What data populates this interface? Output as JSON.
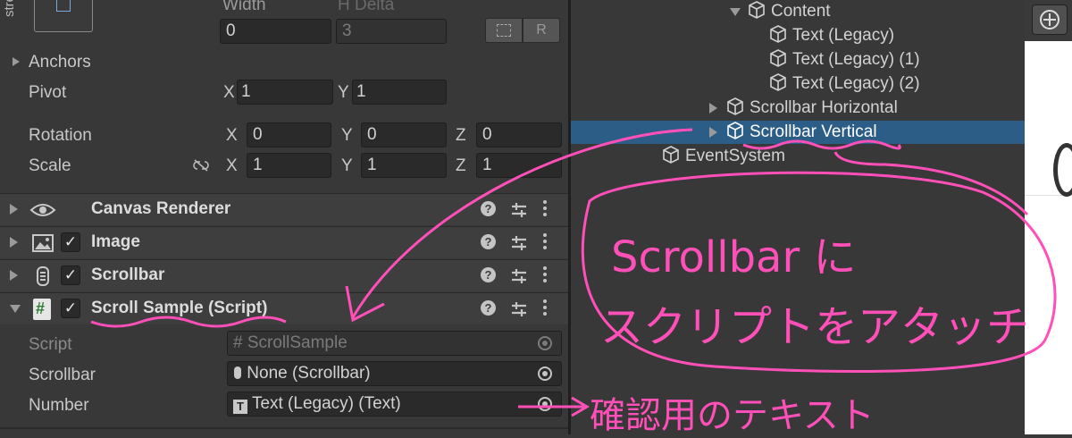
{
  "rect_transform": {
    "stretch_label": "stre",
    "width_label": "Width",
    "h_delta_label": "H Delta",
    "width_value": "0",
    "h_delta_value": "3",
    "raw_button_label": "R",
    "anchors_label": "Anchors",
    "pivot_label": "Pivot",
    "pivot_x": "1",
    "pivot_y": "1",
    "rotation_label": "Rotation",
    "rotation_x": "0",
    "rotation_y": "0",
    "rotation_z": "0",
    "scale_label": "Scale",
    "scale_x": "1",
    "scale_y": "1",
    "scale_z": "1",
    "axis_x": "X",
    "axis_y": "Y",
    "axis_z": "Z"
  },
  "components": [
    {
      "title": "Canvas Renderer",
      "icon": "eye-icon",
      "has_checkbox": false
    },
    {
      "title": "Image",
      "icon": "image-icon",
      "has_checkbox": true
    },
    {
      "title": "Scrollbar",
      "icon": "scrollbar-icon",
      "has_checkbox": true
    },
    {
      "title": "Scroll Sample (Script)",
      "icon": "script-icon",
      "has_checkbox": true
    }
  ],
  "script_fields": {
    "script_label": "Script",
    "script_value": "ScrollSample",
    "scrollbar_label": "Scrollbar",
    "scrollbar_value": "None (Scrollbar)",
    "number_label": "Number",
    "number_value": "Text (Legacy) (Text)"
  },
  "hierarchy": {
    "content": "Content",
    "text1": "Text (Legacy)",
    "text2": "Text (Legacy) (1)",
    "text3": "Text (Legacy) (2)",
    "scrollbar_horizontal": "Scrollbar Horizontal",
    "scrollbar_vertical": "Scrollbar Vertical",
    "event_system": "EventSystem"
  },
  "annotations": {
    "line1": "Scrollbar に",
    "line2": "スクリプトをアタッチ",
    "note": "確認用のテキスト"
  },
  "colors": {
    "annotation": "#ff4fb8",
    "selection": "#2c5d87"
  }
}
